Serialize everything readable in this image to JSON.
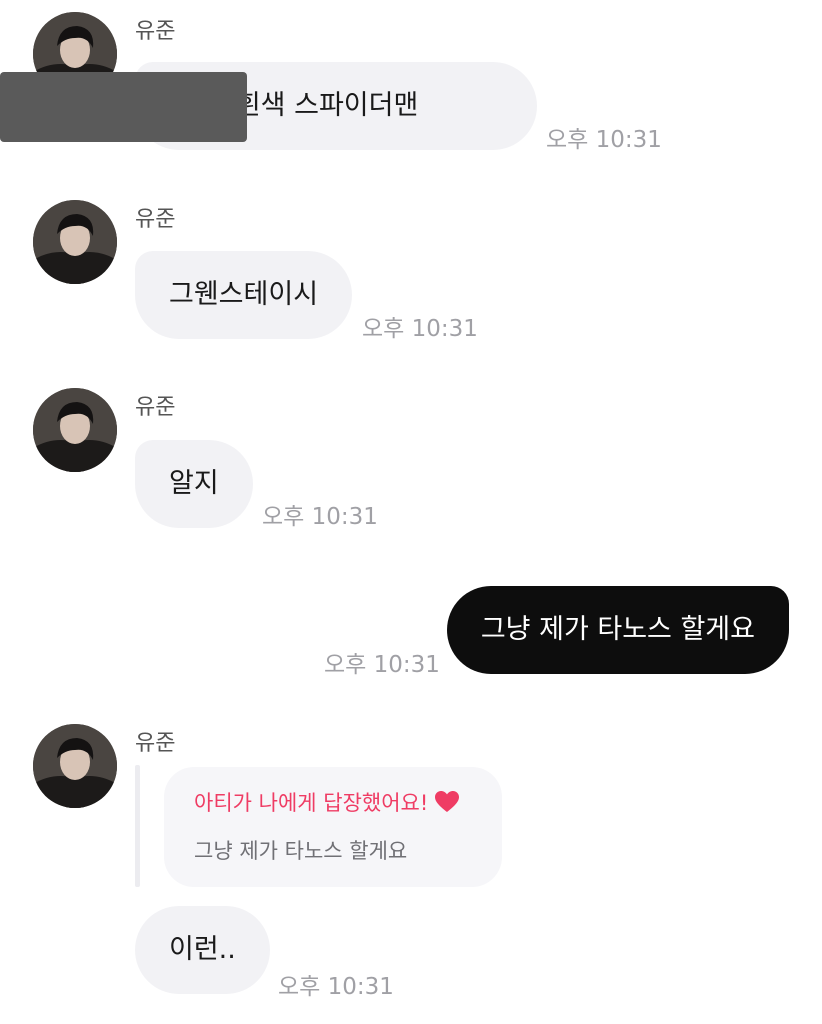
{
  "sender": {
    "name": "유준"
  },
  "messages": [
    {
      "direction": "in",
      "text": "는 그 흰색 스파이더맨",
      "time": "오후 10:31",
      "partially_redacted": true
    },
    {
      "direction": "in",
      "text": "그웬스테이시",
      "time": "오후 10:31"
    },
    {
      "direction": "in",
      "text": "알지",
      "time": "오후 10:31"
    },
    {
      "direction": "out",
      "text": "그냥 제가 타노스 할게요",
      "time": "오후 10:31"
    },
    {
      "direction": "in",
      "text": "이런..",
      "time": "오후 10:31"
    }
  ],
  "reply": {
    "title": "아티가 나에게 답장했어요!",
    "quoted_text": "그냥 제가 타노스 할게요",
    "icon": "heart-icon",
    "accent": "#ef3c64"
  },
  "colors": {
    "incoming_bubble": "#f2f2f5",
    "outgoing_bubble": "#0d0d0d",
    "time_text": "#a0a0a5"
  }
}
